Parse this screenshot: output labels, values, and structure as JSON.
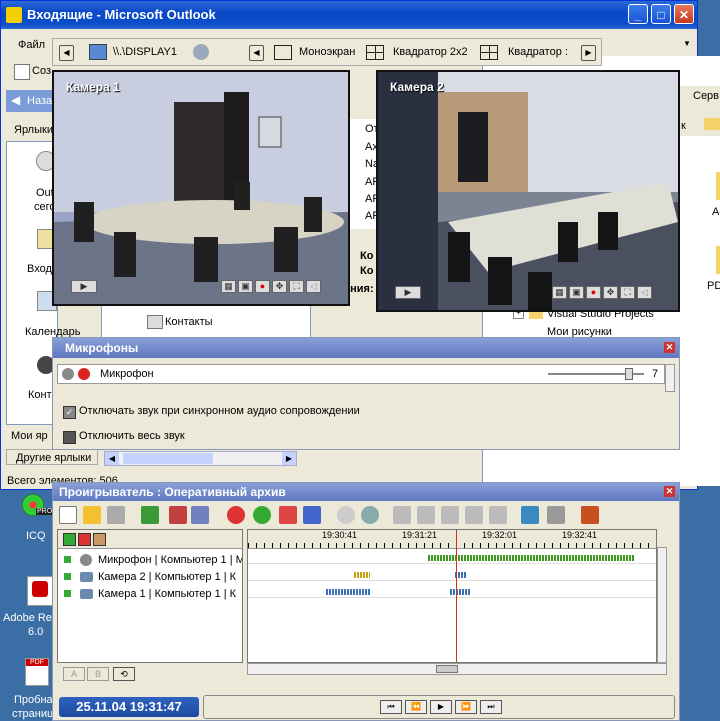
{
  "outlook": {
    "title": "Входящие - Microsoft Outlook",
    "menu_file": "Файл",
    "create": "Соз",
    "back": "Наза",
    "shortcuts_header": "Ярлыки",
    "nav_items": [
      "Outl",
      "сего",
      "Входя",
      "Календарь",
      "Конт"
    ],
    "my_shortcuts": "Мои яр",
    "other_shortcuts": "Другие ярлыки",
    "status": "Всего элементов: 506",
    "folder_contacts": "Контакты",
    "mail_rows": [
      "От",
      "Ах",
      "Na",
      "AF",
      "AF",
      "AF"
    ],
    "preview_lines": [
      "Ко",
      "Ко",
      "ания:"
    ]
  },
  "explorer": {
    "serv": "Серв",
    "k": "к",
    "tree_visual_studio": "Visual Studio Projects",
    "tree_my_pictures": "Мои рисунки",
    "ac": "Ac",
    "pd": "PD"
  },
  "display_bar": {
    "display": "\\\\.\\DISPLAY1",
    "mono": "Моноэкран",
    "quad": "Квадратор 2x2",
    "quad2": "Квадратор :"
  },
  "cameras": [
    {
      "label": "Камера  1"
    },
    {
      "label": "Камера  2"
    }
  ],
  "mic_panel": {
    "title": "Микрофоны",
    "mic_name": "Микрофон",
    "volume": "7",
    "volume_level": 0.85,
    "opt1": "Отключать звук при синхронном аудио сопровождении",
    "opt1_checked": true,
    "opt2": "Отключить весь звук",
    "opt2_checked": false
  },
  "player": {
    "title": "Проигрыватель : Оперативный архив",
    "tracks": [
      {
        "label": "Микрофон | Компьютер 1 | М"
      },
      {
        "label": "Камера  2 | Компьютер 1 | К"
      },
      {
        "label": "Камера  1 | Компьютер 1 | К"
      }
    ],
    "ticks": [
      "19:30:41",
      "19:31:21",
      "19:32:01",
      "19:32:41"
    ],
    "datetime": "25.11.04 19:31:47",
    "bottom_buttons": [
      "A",
      "B"
    ]
  },
  "desktop": {
    "icq": "ICQ",
    "adobe1": "Adobe Rea",
    "adobe2": "6.0",
    "pdf1": "Пробна",
    "pdf2": "страниц",
    "pro": "PRO"
  },
  "colors": {
    "xp_blue": "#0a48c8",
    "panel": "#ece9d8",
    "mic_title": "#6f86cc",
    "red_line": "#d03020"
  }
}
